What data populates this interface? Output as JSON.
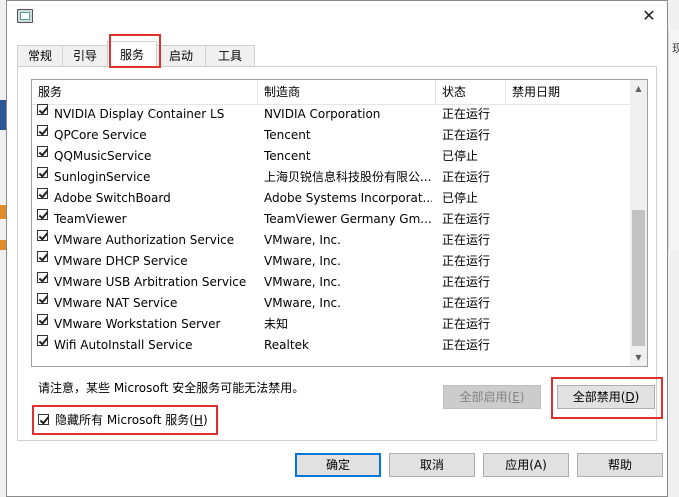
{
  "background": {
    "side_text": "现"
  },
  "window": {
    "close_glyph": "✕"
  },
  "tabs": [
    {
      "label": "常规"
    },
    {
      "label": "引导"
    },
    {
      "label": "服务"
    },
    {
      "label": "启动"
    },
    {
      "label": "工具"
    }
  ],
  "columns": {
    "service": "服务",
    "manufacturer": "制造商",
    "status": "状态",
    "disabled_date": "禁用日期"
  },
  "services": [
    {
      "name": "NVIDIA Display Container LS",
      "manufacturer": "NVIDIA Corporation",
      "status": "正在运行",
      "checked": true
    },
    {
      "name": "QPCore Service",
      "manufacturer": "Tencent",
      "status": "正在运行",
      "checked": true
    },
    {
      "name": "QQMusicService",
      "manufacturer": "Tencent",
      "status": "已停止",
      "checked": true
    },
    {
      "name": "SunloginService",
      "manufacturer": "上海贝锐信息科技股份有限公...",
      "status": "正在运行",
      "checked": true
    },
    {
      "name": "Adobe SwitchBoard",
      "manufacturer": "Adobe Systems Incorporat...",
      "status": "已停止",
      "checked": true
    },
    {
      "name": "TeamViewer",
      "manufacturer": "TeamViewer Germany Gm...",
      "status": "正在运行",
      "checked": true
    },
    {
      "name": "VMware Authorization Service",
      "manufacturer": "VMware, Inc.",
      "status": "正在运行",
      "checked": true
    },
    {
      "name": "VMware DHCP Service",
      "manufacturer": "VMware, Inc.",
      "status": "正在运行",
      "checked": true
    },
    {
      "name": "VMware USB Arbitration Service",
      "manufacturer": "VMware, Inc.",
      "status": "正在运行",
      "checked": true
    },
    {
      "name": "VMware NAT Service",
      "manufacturer": "VMware, Inc.",
      "status": "正在运行",
      "checked": true
    },
    {
      "name": "VMware Workstation Server",
      "manufacturer": "未知",
      "status": "正在运行",
      "checked": true
    },
    {
      "name": "Wifi AutoInstall Service",
      "manufacturer": "Realtek",
      "status": "正在运行",
      "checked": true
    }
  ],
  "note": "请注意，某些 Microsoft 安全服务可能无法禁用。",
  "buttons": {
    "enable_all_text": "全部启用(",
    "enable_all_key": "E",
    "enable_all_end": ")",
    "disable_all_text": "全部禁用(",
    "disable_all_key": "D",
    "disable_all_end": ")",
    "ok": "确定",
    "cancel": "取消",
    "apply": "应用(A)",
    "help": "帮助"
  },
  "hide_ms": {
    "text": "隐藏所有 Microsoft 服务(",
    "key": "H",
    "end": ")",
    "checked": true
  },
  "colors": {
    "highlight": "#e0302b",
    "focus": "#0078d7"
  }
}
